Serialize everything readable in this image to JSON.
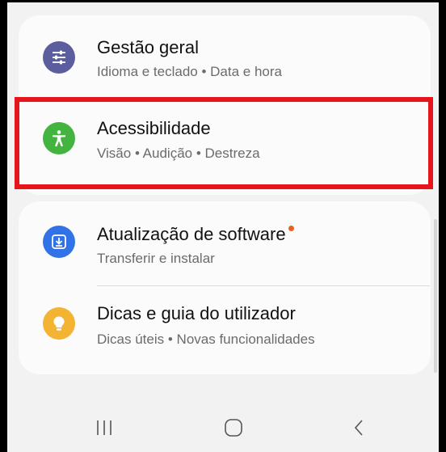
{
  "settings": {
    "items": [
      {
        "title": "Gestão geral",
        "subtitle": "Idioma e teclado • Data e hora",
        "icon": "sliders-icon",
        "color": "#5c5d9e"
      },
      {
        "title": "Acessibilidade",
        "subtitle": "Visão • Audição • Destreza",
        "icon": "accessibility-icon",
        "color": "#44b441"
      },
      {
        "title": "Atualização de software",
        "subtitle": "Transferir e instalar",
        "icon": "download-icon",
        "color": "#3173e6"
      },
      {
        "title": "Dicas e guia do utilizador",
        "subtitle": "Dicas úteis • Novas funcionalidades",
        "icon": "lightbulb-icon",
        "color": "#f4b433"
      }
    ],
    "notification_dot_color": "#e8621e",
    "highlight_color": "#e8141b"
  },
  "navbar": {
    "buttons": [
      "recents-button",
      "home-button",
      "back-button"
    ]
  }
}
